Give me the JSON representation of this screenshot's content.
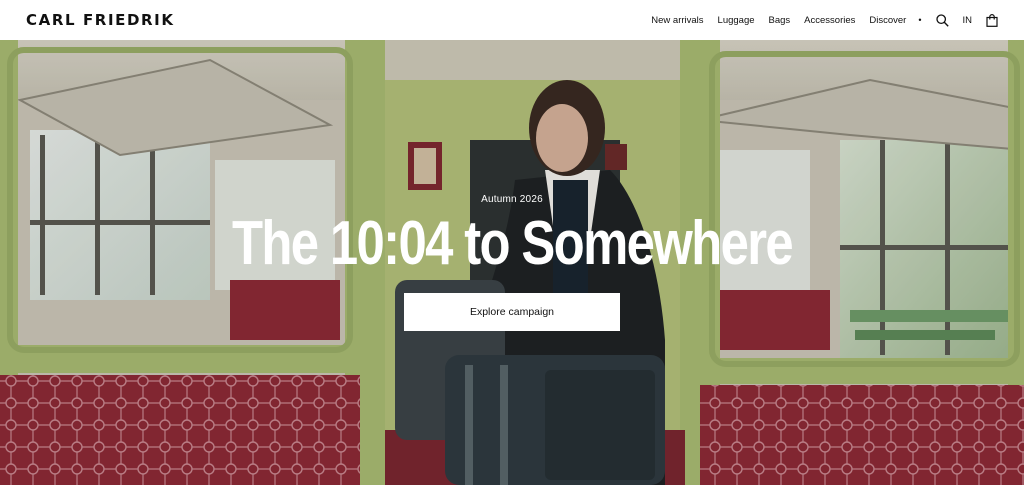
{
  "brand": {
    "logo_text": "CARL FRIEDRIK"
  },
  "nav": {
    "items": [
      {
        "label": "New arrivals"
      },
      {
        "label": "Luggage"
      },
      {
        "label": "Bags"
      },
      {
        "label": "Accessories"
      },
      {
        "label": "Discover"
      }
    ],
    "separator": "•",
    "search_icon": "search-icon",
    "language": "IN",
    "cart_icon": "shopping-bag-icon"
  },
  "hero": {
    "eyebrow": "Autumn 2026",
    "headline": "The 10:04 to Somewhere",
    "cta_label": "Explore campaign"
  },
  "colors": {
    "header_bg": "#ffffff",
    "text": "#111111",
    "train_green": "#a9bb72",
    "seat_red": "#8c2a36",
    "cta_bg": "#ffffff"
  }
}
